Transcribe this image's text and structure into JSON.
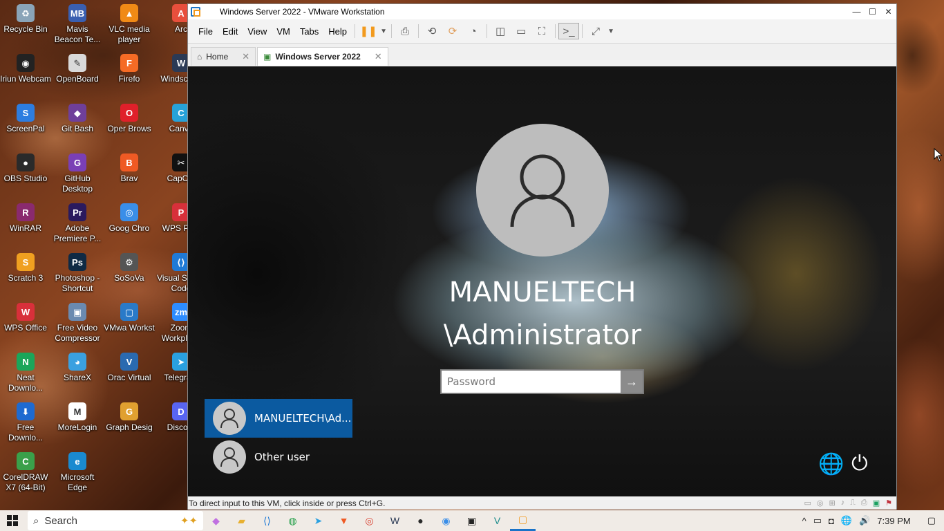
{
  "desktop": {
    "icons": [
      {
        "label": "Recycle Bin",
        "icon": "recycle-bin-icon",
        "color": "#8aa4b8",
        "glyph": "♻"
      },
      {
        "label": "Mavis Beacon Te...",
        "icon": "mavis-beacon-icon",
        "color": "#3a5fb0",
        "glyph": "MB"
      },
      {
        "label": "VLC media player",
        "icon": "vlc-icon",
        "color": "#f08a16",
        "glyph": "▲"
      },
      {
        "label": "Arc",
        "icon": "arc-icon",
        "color": "#e84f3c",
        "glyph": "A"
      },
      {
        "label": "Iriun Webcam",
        "icon": "iriun-webcam-icon",
        "color": "#222222",
        "glyph": "◉"
      },
      {
        "label": "OpenBoard",
        "icon": "openboard-icon",
        "color": "#d9d9d9",
        "glyph": "✎"
      },
      {
        "label": "Firefo",
        "icon": "firefox-icon",
        "color": "#f56b25",
        "glyph": "F"
      },
      {
        "label": "Windscribe",
        "icon": "windscribe-icon",
        "color": "#2b3a55",
        "glyph": "W"
      },
      {
        "label": "ScreenPal",
        "icon": "screenpal-icon",
        "color": "#2d7de0",
        "glyph": "S"
      },
      {
        "label": "Git Bash",
        "icon": "git-bash-icon",
        "color": "#6f3f9a",
        "glyph": "◆"
      },
      {
        "label": "Oper Brows",
        "icon": "opera-icon",
        "color": "#e0202a",
        "glyph": "O"
      },
      {
        "label": "Canva",
        "icon": "canva-icon",
        "color": "#27a2d8",
        "glyph": "C"
      },
      {
        "label": "OBS Studio",
        "icon": "obs-studio-icon",
        "color": "#2a2a2a",
        "glyph": "●"
      },
      {
        "label": "GitHub Desktop",
        "icon": "github-desktop-icon",
        "color": "#7a3fb5",
        "glyph": "G"
      },
      {
        "label": "Brav",
        "icon": "brave-icon",
        "color": "#ef5a24",
        "glyph": "B"
      },
      {
        "label": "CapCut",
        "icon": "capcut-icon",
        "color": "#111111",
        "glyph": "✂"
      },
      {
        "label": "WinRAR",
        "icon": "winrar-icon",
        "color": "#8a2a6e",
        "glyph": "R"
      },
      {
        "label": "Adobe Premiere P...",
        "icon": "premiere-pro-icon",
        "color": "#2a1a5e",
        "glyph": "Pr"
      },
      {
        "label": "Goog Chro",
        "icon": "chrome-icon",
        "color": "#3a8ee8",
        "glyph": "◎"
      },
      {
        "label": "WPS PDF",
        "icon": "wps-pdf-icon",
        "color": "#d8303a",
        "glyph": "P"
      },
      {
        "label": "Scratch 3",
        "icon": "scratch-icon",
        "color": "#f0a020",
        "glyph": "S"
      },
      {
        "label": "Photoshop - Shortcut",
        "icon": "photoshop-icon",
        "color": "#0f2a44",
        "glyph": "Ps"
      },
      {
        "label": "SoSoVa",
        "icon": "sosova-icon",
        "color": "#555555",
        "glyph": "⚙"
      },
      {
        "label": "Visual Studio Code",
        "icon": "vscode-icon",
        "color": "#1f7ad6",
        "glyph": "⟨⟩"
      },
      {
        "label": "WPS Office",
        "icon": "wps-office-icon",
        "color": "#d8303a",
        "glyph": "W"
      },
      {
        "label": "Free Video Compressor",
        "icon": "free-video-compressor-icon",
        "color": "#6a8ab0",
        "glyph": "▣"
      },
      {
        "label": "VMwa Workst",
        "icon": "vmware-icon",
        "color": "#2a7ac8",
        "glyph": "▢"
      },
      {
        "label": "Zoom Workplace",
        "icon": "zoom-icon",
        "color": "#2d8cff",
        "glyph": "zm"
      },
      {
        "label": "Neat Downlo...",
        "icon": "neat-download-icon",
        "color": "#1aa65a",
        "glyph": "N"
      },
      {
        "label": "ShareX",
        "icon": "sharex-icon",
        "color": "#3aa0e0",
        "glyph": "◕"
      },
      {
        "label": "Orac Virtual",
        "icon": "virtualbox-icon",
        "color": "#2a6ab0",
        "glyph": "V"
      },
      {
        "label": "Telegram",
        "icon": "telegram-icon",
        "color": "#2aa0e0",
        "glyph": "➤"
      },
      {
        "label": "Free Downlo...",
        "icon": "free-download-icon",
        "color": "#1e6ad0",
        "glyph": "⬇"
      },
      {
        "label": "MoreLogin",
        "icon": "morelogin-icon",
        "color": "#ffffff",
        "glyph": "M"
      },
      {
        "label": "Graph Desig",
        "icon": "graphic-design-icon",
        "color": "#e0a030",
        "glyph": "G"
      },
      {
        "label": "Discord",
        "icon": "discord-icon",
        "color": "#5865f2",
        "glyph": "D"
      },
      {
        "label": "CorelDRAW X7 (64-Bit)",
        "icon": "coreldraw-icon",
        "color": "#3aa04a",
        "glyph": "C"
      },
      {
        "label": "Microsoft Edge",
        "icon": "edge-icon",
        "color": "#1a8ad0",
        "glyph": "e"
      }
    ]
  },
  "window": {
    "title": "Windows Server 2022 - VMware Workstation",
    "menu": [
      "File",
      "Edit",
      "View",
      "VM",
      "Tabs",
      "Help"
    ],
    "tabs": [
      {
        "label": "Home",
        "active": false
      },
      {
        "label": "Windows Server 2022",
        "active": true
      }
    ]
  },
  "vm": {
    "user_name": "MANUELTECH \\Administrator",
    "password_placeholder": "Password",
    "user_tiles": [
      {
        "label": "MANUELTECH\\Ad...",
        "selected": true
      },
      {
        "label": "Other user",
        "selected": false
      }
    ]
  },
  "status": {
    "message": "To direct input to this VM, click inside or press Ctrl+G."
  },
  "taskbar": {
    "search_label": "Search",
    "time": "7:39 PM"
  }
}
